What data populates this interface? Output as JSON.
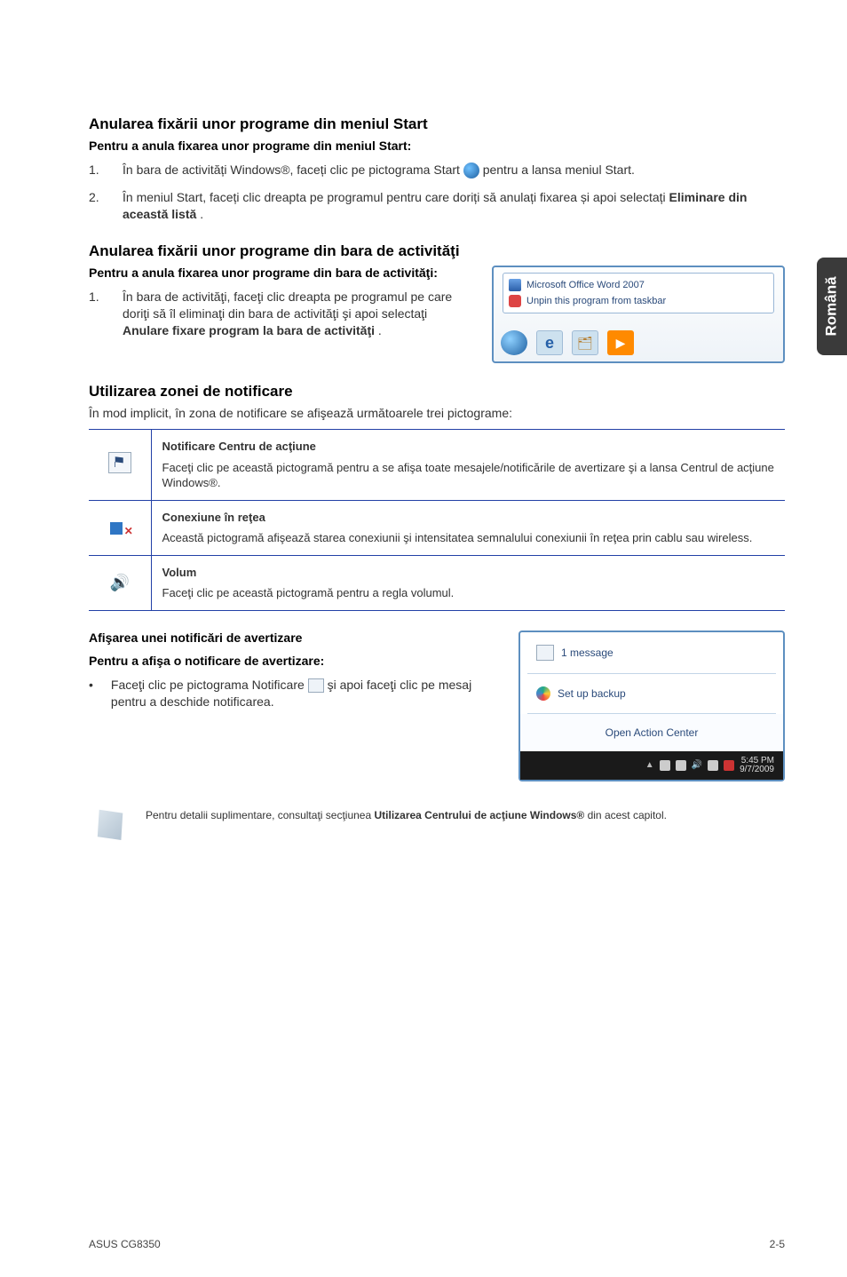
{
  "sideTab": "Română",
  "sec1": {
    "title": "Anularea fixării unor programe din meniul Start",
    "sub": "Pentru a anula fixarea unor programe din meniul Start:",
    "step1_pre": "În bara de activități Windows®, faceți clic pe pictograma Start ",
    "step1_post": " pentru a lansa meniul Start.",
    "step2_pre": "În meniul Start, faceți clic dreapta pe programul pentru care doriți să anulați fixarea și apoi selectați ",
    "step2_bold": "Eliminare din această listă",
    "step2_post": "."
  },
  "sec2": {
    "title": "Anularea fixării unor programe din bara de activităţi",
    "sub": "Pentru a anula fixarea unor programe din bara de activităţi:",
    "step1_pre": "În bara de activităţi, faceţi clic dreapta pe programul pe care doriţi să îl eliminaţi din bara de activităţi şi apoi selectaţi ",
    "step1_bold": "Anulare fixare program la bara de activităţi",
    "step1_post": ".",
    "img_row1": "Microsoft Office Word 2007",
    "img_row2": "Unpin this program from taskbar"
  },
  "sec3": {
    "title": "Utilizarea zonei de notificare",
    "intro": "În mod implicit, în zona de notificare se afişează următoarele trei pictograme:",
    "rows": [
      {
        "title": "Notificare Centru de acţiune",
        "desc": "Faceţi clic pe această pictogramă pentru a se afişa toate mesajele/notificările de avertizare şi a lansa Centrul de acţiune Windows®."
      },
      {
        "title": "Conexiune în reţea",
        "desc": "Această pictogramă afişează starea conexiunii şi intensitatea semnalului conexiunii în reţea prin cablu sau wireless."
      },
      {
        "title": "Volum",
        "desc": "Faceţi clic pe această pictogramă pentru a regla volumul."
      }
    ]
  },
  "sec4": {
    "title": "Afişarea unei notificări de avertizare",
    "sub": "Pentru a afişa o notificare de avertizare:",
    "bullet_pre": "Faceţi clic pe pictograma Notificare ",
    "bullet_post": " şi apoi faceţi clic pe mesaj pentru a deschide notificarea.",
    "img_msg": "1 message",
    "img_setup": "Set up backup",
    "img_open": "Open Action Center",
    "img_time": "5:45 PM",
    "img_date": "9/7/2009"
  },
  "note": {
    "pre": "Pentru detalii suplimentare, consultaţi secţiunea ",
    "bold": "Utilizarea Centrului de acţiune Windows®",
    "post": " din acest capitol."
  },
  "footer": {
    "left": "ASUS CG8350",
    "right": "2-5"
  },
  "nums": {
    "n1": "1.",
    "n2": "2."
  }
}
